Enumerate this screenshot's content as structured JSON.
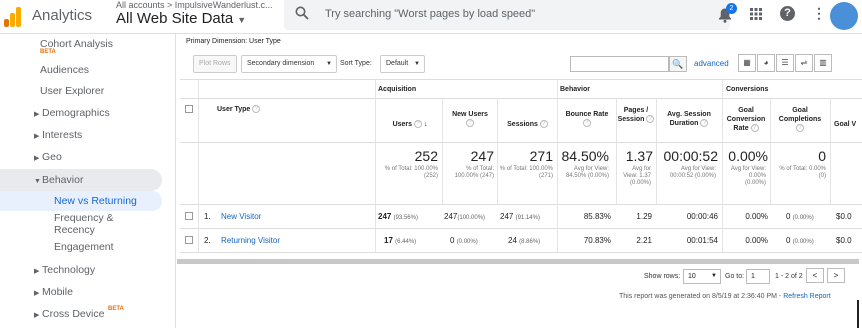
{
  "app": {
    "title": "Analytics",
    "breadcrumb": "All accounts > ImpulsiveWanderlust.c...",
    "view_name": "All Web Site Data",
    "search_placeholder": "Try searching \"Worst pages by load speed\"",
    "notification_count": "2",
    "help": "?",
    "more": "⋮"
  },
  "sidebar": {
    "items": [
      {
        "label": "Cohort Analysis",
        "beta": "BETA"
      },
      {
        "label": "Audiences"
      },
      {
        "label": "User Explorer"
      },
      {
        "label": "Demographics"
      },
      {
        "label": "Interests"
      },
      {
        "label": "Geo"
      },
      {
        "label": "Behavior"
      },
      {
        "label": "New vs Returning"
      },
      {
        "label": "Frequency &"
      },
      {
        "label": "Recency"
      },
      {
        "label": "Engagement"
      },
      {
        "label": "Technology"
      },
      {
        "label": "Mobile"
      },
      {
        "label": "Cross Device",
        "beta": "BETA"
      }
    ]
  },
  "toolbar": {
    "primary_dimension_label": "Primary Dimension:",
    "primary_dimension_value": "User Type",
    "plot_rows": "Plot Rows",
    "secondary_dimension": "Secondary dimension",
    "sort_type_label": "Sort Type:",
    "sort_type_value": "Default",
    "advanced": "advanced"
  },
  "table": {
    "groups": {
      "acquisition": "Acquisition",
      "behavior": "Behavior",
      "conversions": "Conversions"
    },
    "columns": {
      "user_type": "User Type",
      "users": "Users",
      "new_users": "New Users",
      "sessions": "Sessions",
      "bounce_rate": "Bounce Rate",
      "pages_session": "Pages / Session",
      "avg_session": "Avg. Session Duration",
      "goal_conv": "Goal Conversion Rate",
      "goal_comp": "Goal Completions",
      "goal_value": "Goal V"
    },
    "totals": {
      "users": {
        "big": "252",
        "small": "% of Total: 100.00% (252)"
      },
      "new_users": {
        "big": "247",
        "small": "% of Total: 100.00% (247)"
      },
      "sessions": {
        "big": "271",
        "small": "% of Total: 100.00% (271)"
      },
      "bounce_rate": {
        "big": "84.50%",
        "small": "Avg for View: 84.50% (0.00%)"
      },
      "pages_session": {
        "big": "1.37",
        "small": "Avg for View: 1.37 (0.00%)"
      },
      "avg_session": {
        "big": "00:00:52",
        "small": "Avg for View: 00:00:52 (0.00%)"
      },
      "goal_conv": {
        "big": "0.00%",
        "small": "Avg for View: 0.00% (0.00%)"
      },
      "goal_comp": {
        "big": "0",
        "small": "% of Total: 0.00% (0)"
      }
    },
    "rows": [
      {
        "num": "1.",
        "type": "New Visitor",
        "users": "247",
        "users_pct": "(93.56%)",
        "new_users": "247",
        "new_users_pct": "(100.00%)",
        "sessions": "247",
        "sessions_pct": "(91.14%)",
        "bounce": "85.83%",
        "pages": "1.29",
        "duration": "00:00:46",
        "conv": "0.00%",
        "comp": "0",
        "comp_pct": "(0.00%)",
        "value": "$0.0"
      },
      {
        "num": "2.",
        "type": "Returning Visitor",
        "users": "17",
        "users_pct": "(6.44%)",
        "new_users": "0",
        "new_users_pct": "(0.00%)",
        "sessions": "24",
        "sessions_pct": "(8.86%)",
        "bounce": "70.83%",
        "pages": "2.21",
        "duration": "00:01:54",
        "conv": "0.00%",
        "comp": "0",
        "comp_pct": "(0.00%)",
        "value": "$0.0"
      }
    ]
  },
  "footer": {
    "show_rows_label": "Show rows:",
    "show_rows_value": "10",
    "goto_label": "Go to:",
    "goto_value": "1",
    "range": "1 - 2 of 2",
    "generated": "This report was generated on 8/5/19 at 2:36:40 PM -",
    "refresh": "Refresh Report"
  },
  "colors": {
    "accent": "#1a73e8",
    "link": "#1565c0",
    "logo_orange": "#f9ab00",
    "logo_dark": "#e37400"
  }
}
